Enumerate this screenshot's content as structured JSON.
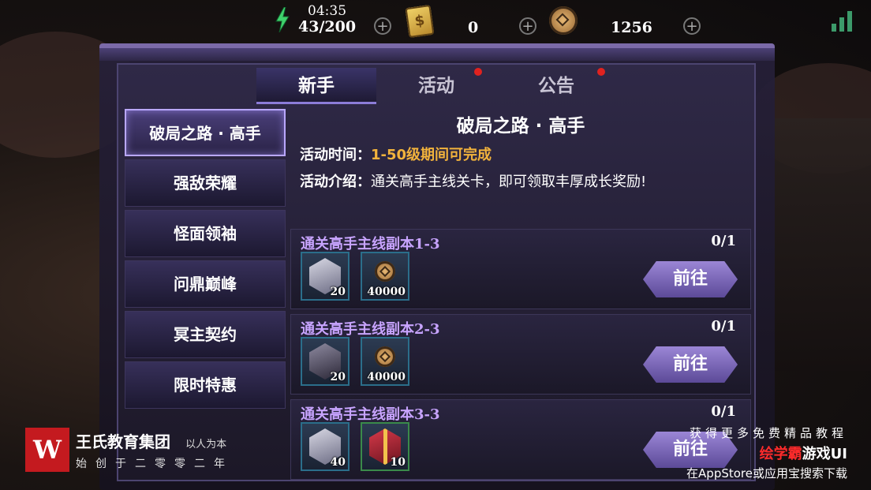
{
  "topbar": {
    "stamina_time": "04:35",
    "stamina_value": "43/200",
    "ticket_value": "0",
    "coin_value": "1256",
    "plus_label": "+",
    "ticket_symbol": "$"
  },
  "tabs": [
    {
      "label": "新手",
      "active": true
    },
    {
      "label": "活动",
      "has_dot": true
    },
    {
      "label": "公告",
      "has_dot": true
    }
  ],
  "sidebar": {
    "items": [
      {
        "label": "破局之路 · 高手",
        "active": true
      },
      {
        "label": "强敌荣耀"
      },
      {
        "label": "怪面领袖"
      },
      {
        "label": "问鼎巅峰"
      },
      {
        "label": "冥主契约"
      },
      {
        "label": "限时特惠"
      }
    ]
  },
  "detail": {
    "title": "破局之路 · 高手",
    "time_label": "活动时间：",
    "time_value": "1-50级期间可完成",
    "intro_label": "活动介绍：",
    "intro_value": "通关高手主线关卡，即可领取丰厚成长奖励!"
  },
  "tasks": [
    {
      "name": "通关高手主线副本1-3",
      "progress": "0/1",
      "rewards": [
        {
          "type": "hero",
          "count": "20"
        },
        {
          "type": "coin",
          "count": "40000"
        }
      ],
      "button": "前往"
    },
    {
      "name": "通关高手主线副本2-3",
      "progress": "0/1",
      "rewards": [
        {
          "type": "hero-dark",
          "count": "20"
        },
        {
          "type": "coin",
          "count": "40000"
        }
      ],
      "button": "前往"
    },
    {
      "name": "通关高手主线副本3-3",
      "progress": "0/1",
      "rewards": [
        {
          "type": "hero",
          "count": "40"
        },
        {
          "type": "gift",
          "count": "10"
        }
      ],
      "button": "前往"
    }
  ],
  "watermark": {
    "logo": "W",
    "name": "王氏教育集团",
    "motto": "以人为本",
    "sub": "始创于二零零二年",
    "right_line1": "获得更多免费精品教程",
    "right_red": "绘学霸",
    "right_white": "游戏UI",
    "right_line3": "在AppStore或应用宝搜索下载"
  },
  "colors": {
    "accent": "#8c7cd8",
    "highlight": "#f2b33c",
    "task_name": "#c8a4ff",
    "red_dot": "#e0221f"
  }
}
